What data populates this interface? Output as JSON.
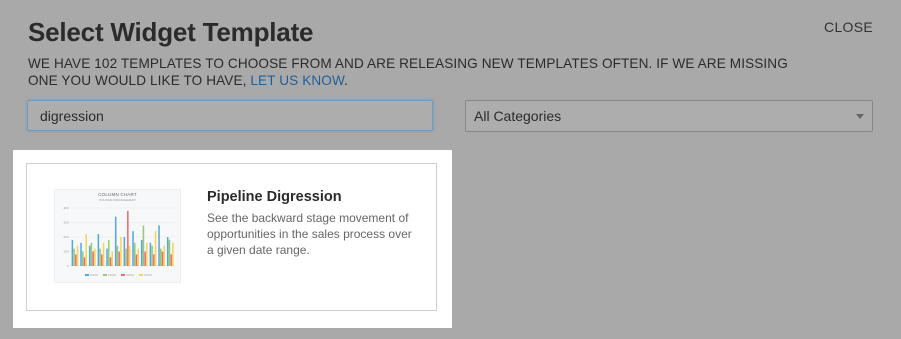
{
  "dialog": {
    "title": "Select Widget Template",
    "close_label": "CLOSE",
    "description": "WE HAVE 102 TEMPLATES TO CHOOSE FROM AND ARE RELEASING NEW TEMPLATES OFTEN. IF WE ARE MISSING ONE YOU WOULD LIKE TO HAVE, ",
    "link_label": "LET US KNOW",
    "description_end": "."
  },
  "search": {
    "value": "digression"
  },
  "category_select": {
    "selected": "All Categories"
  },
  "templates": [
    {
      "title": "Pipeline Digression",
      "description": "See the backward stage movement of opportunities in the sales process over a given date range.",
      "thumbnail": {
        "title": "COLUMN CHART",
        "subtitle": "SOURCE ARRANGEMENT",
        "y_ticks": [
          "400",
          "300",
          "200",
          "100",
          "0"
        ],
        "series_colors": [
          "#4fa9e0",
          "#9bc96b",
          "#ef6b6b",
          "#f6d45a"
        ]
      }
    }
  ]
}
